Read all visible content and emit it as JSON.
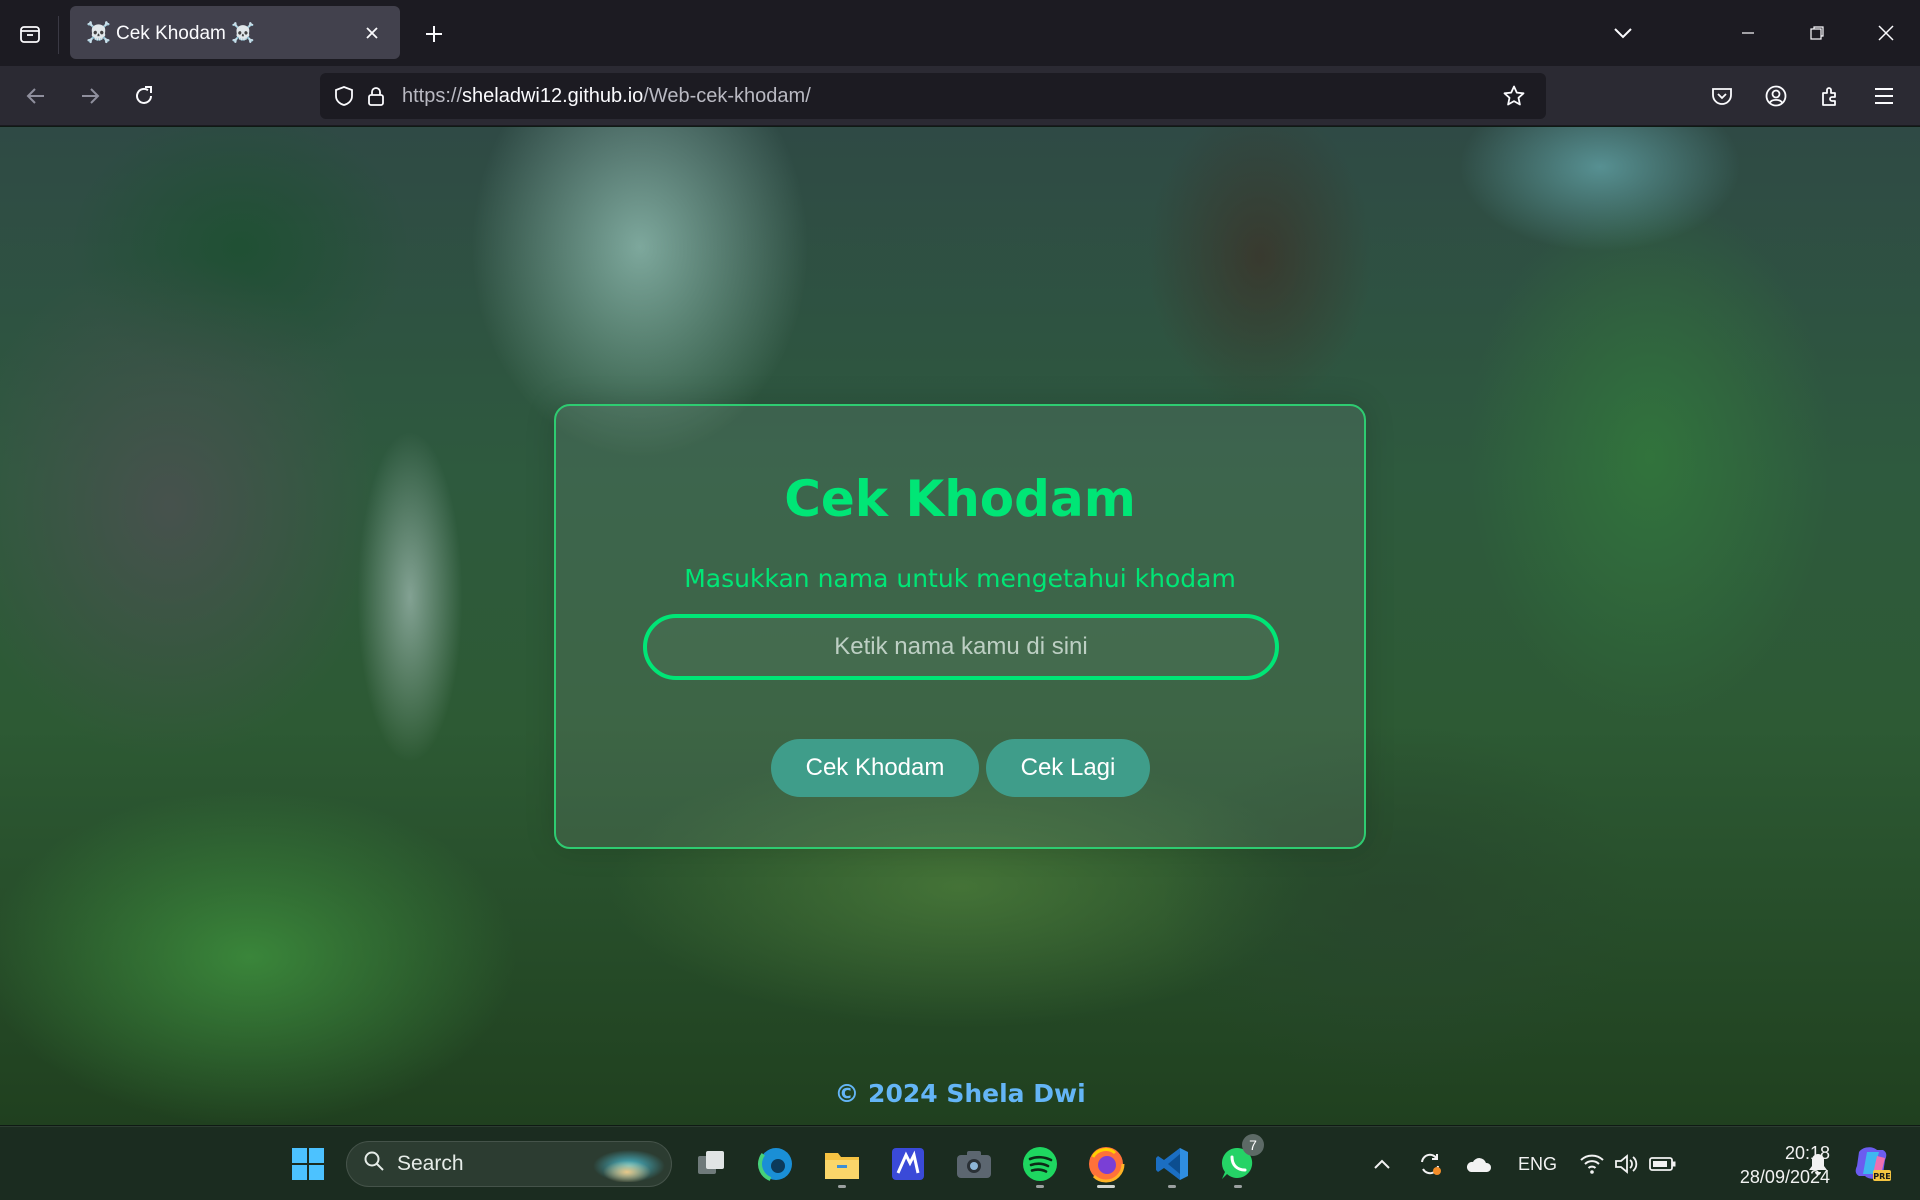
{
  "browser": {
    "tab": {
      "icon": "☠️",
      "icon_end": "☠️",
      "title": "Cek Khodam"
    },
    "url": {
      "scheme": "https://",
      "host": "sheladwi12.github.io",
      "path": "/Web-cek-khodam/"
    },
    "icons": [
      "tab-list-icon",
      "close-icon",
      "plus-icon",
      "chevron-down-icon",
      "minimize-icon",
      "restore-icon",
      "window-close-icon",
      "back-arrow-icon",
      "forward-arrow-icon",
      "reload-icon",
      "shield-icon",
      "lock-icon",
      "star-icon",
      "pocket-icon",
      "account-icon",
      "extensions-icon",
      "menu-icon"
    ]
  },
  "page": {
    "title": "Cek Khodam",
    "subtitle": "Masukkan nama untuk mengetahui khodam",
    "input": {
      "value": "",
      "placeholder": "Ketik nama kamu di sini"
    },
    "buttons": {
      "check": "Cek Khodam",
      "again": "Cek Lagi"
    },
    "footer": "© 2024 Shela Dwi",
    "colors": {
      "accent": "#00e676",
      "button": "#3f9d8a",
      "footer": "#64b5f6"
    }
  },
  "taskbar": {
    "search_label": "Search",
    "apps": [
      "windows-start-icon",
      "task-view-icon",
      "edge-icon",
      "file-explorer-icon",
      "pen-app-icon",
      "camera-icon",
      "spotify-icon",
      "firefox-icon",
      "vscode-icon",
      "whatsapp-icon"
    ],
    "whatsapp_badge": "7",
    "tray": {
      "language": "ENG",
      "time": "20:18",
      "date": "28/09/2024"
    }
  }
}
